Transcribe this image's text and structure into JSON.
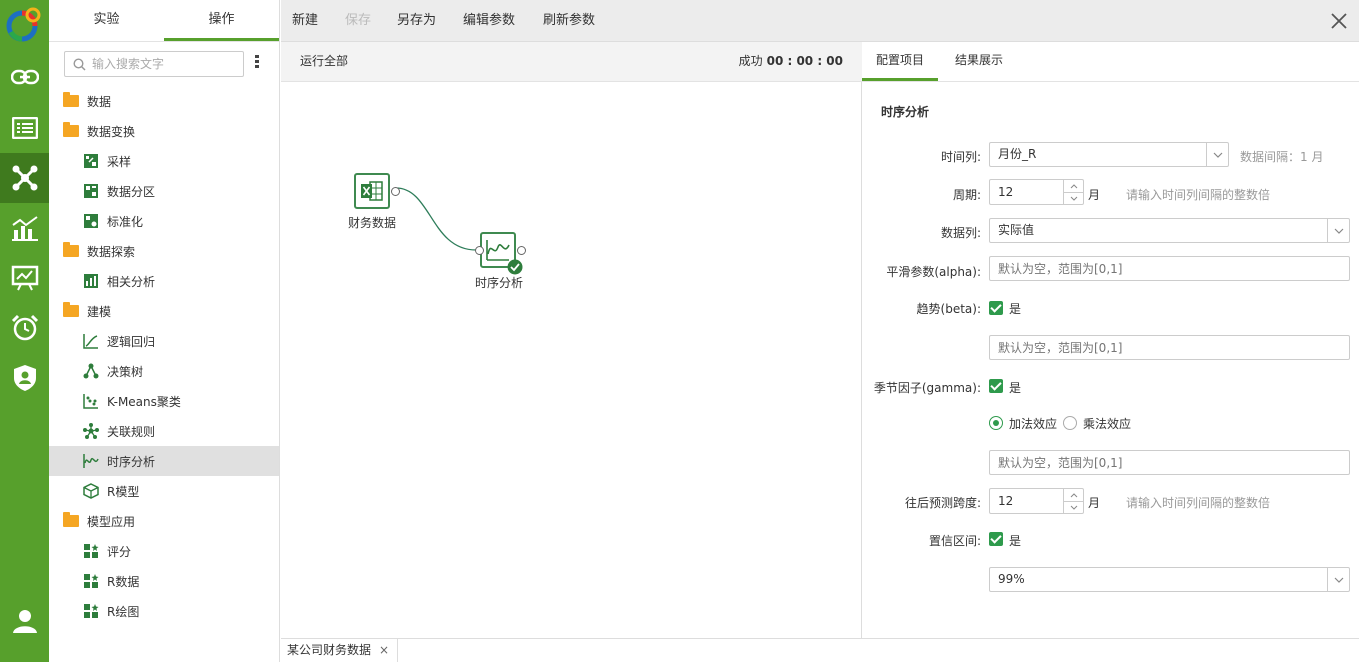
{
  "rail": {
    "items": [
      {
        "icon": "link-icon"
      },
      {
        "icon": "list-icon"
      },
      {
        "icon": "network-icon",
        "active": true
      },
      {
        "icon": "bar-chart-icon"
      },
      {
        "icon": "dashboard-icon"
      },
      {
        "icon": "alarm-clock-icon"
      },
      {
        "icon": "shield-user-icon"
      }
    ],
    "bottom_icon": "user-icon"
  },
  "tree": {
    "tabs": [
      "实验",
      "操作"
    ],
    "active_tab": "操作",
    "search_placeholder": "输入搜索文字",
    "nodes": [
      {
        "label": "数据",
        "level": 0,
        "icon": "folder-icon"
      },
      {
        "label": "数据变换",
        "level": 0,
        "icon": "folder-open-icon"
      },
      {
        "label": "采样",
        "level": 1,
        "icon": "sample-icon"
      },
      {
        "label": "数据分区",
        "level": 1,
        "icon": "partition-icon"
      },
      {
        "label": "标准化",
        "level": 1,
        "icon": "normalize-icon"
      },
      {
        "label": "数据探索",
        "level": 0,
        "icon": "folder-open-icon"
      },
      {
        "label": "相关分析",
        "level": 1,
        "icon": "correlation-icon"
      },
      {
        "label": "建模",
        "level": 0,
        "icon": "folder-open-icon"
      },
      {
        "label": "逻辑回归",
        "level": 1,
        "icon": "regression-icon"
      },
      {
        "label": "决策树",
        "level": 1,
        "icon": "decision-tree-icon"
      },
      {
        "label": "K-Means聚类",
        "level": 1,
        "icon": "cluster-icon"
      },
      {
        "label": "关联规则",
        "level": 1,
        "icon": "association-icon"
      },
      {
        "label": "时序分析",
        "level": 1,
        "icon": "timeseries-icon",
        "selected": true
      },
      {
        "label": "R模型",
        "level": 1,
        "icon": "r-model-icon"
      },
      {
        "label": "模型应用",
        "level": 0,
        "icon": "folder-open-icon"
      },
      {
        "label": "评分",
        "level": 1,
        "icon": "grid-icon"
      },
      {
        "label": "R数据",
        "level": 1,
        "icon": "grid-icon"
      },
      {
        "label": "R绘图",
        "level": 1,
        "icon": "grid-icon"
      }
    ]
  },
  "toolbar": {
    "new_label": "新建",
    "save_label": "保存",
    "save_as_label": "另存为",
    "edit_params_label": "编辑参数",
    "refresh_params_label": "刷新参数"
  },
  "canvas": {
    "run_all_label": "运行全部",
    "status_label": "成功",
    "status_time": "00 : 00 : 00",
    "nodes": [
      {
        "label": "财务数据",
        "icon": "excel-icon"
      },
      {
        "label": "时序分析",
        "icon": "timeseries-icon",
        "status": "success"
      }
    ]
  },
  "config": {
    "tabs": [
      "配置项目",
      "结果展示"
    ],
    "active_tab": "配置项目",
    "section_title": "时序分析",
    "time_column_label": "时间列:",
    "time_column_value": "月份_R",
    "data_interval_hint": "数据间隔：1 月",
    "period_label": "周期:",
    "period_value": "12",
    "period_unit": "月",
    "period_hint": "请输入时间列间隔的整数倍",
    "data_column_label": "数据列:",
    "data_column_value": "实际值",
    "alpha_label": "平滑参数(alpha):",
    "alpha_placeholder": "默认为空，范围为[0,1]",
    "beta_label": "趋势(beta):",
    "beta_checked_label": "是",
    "beta_placeholder": "默认为空，范围为[0,1]",
    "gamma_label": "季节因子(gamma):",
    "gamma_checked_label": "是",
    "additive_label": "加法效应",
    "multiplicative_label": "乘法效应",
    "gamma_placeholder": "默认为空，范围为[0,1]",
    "forecast_label": "往后预测跨度:",
    "forecast_value": "12",
    "forecast_unit": "月",
    "forecast_hint": "请输入时间列间隔的整数倍",
    "confidence_label": "置信区间:",
    "confidence_checked_label": "是",
    "confidence_value": "99%"
  },
  "bottom_tabs": [
    {
      "label": "某公司财务数据"
    }
  ],
  "colors": {
    "brand": "#57a02c",
    "accent": "#2e9a4c"
  }
}
